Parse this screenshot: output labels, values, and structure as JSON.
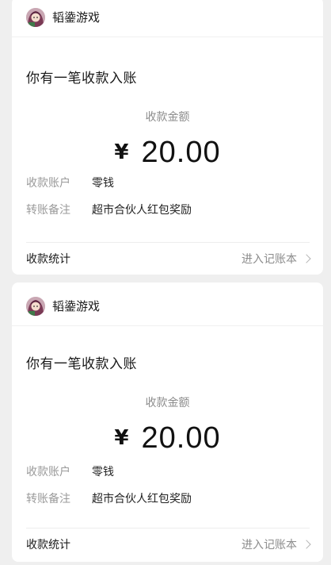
{
  "colors": {
    "background": "#efefef",
    "card": "#ffffff",
    "muted_text": "#8c8c8c",
    "primary_text": "#1a1a1a"
  },
  "cards": [
    {
      "sender": {
        "name": "韬鍌游戏",
        "avatar_icon": "anime-avatar-icon"
      },
      "title": "你有一笔收款入账",
      "amount_label": "收款金额",
      "currency_symbol": "¥",
      "amount": "20.00",
      "details": [
        {
          "key": "收款账户",
          "value": "零钱"
        },
        {
          "key": "转账备注",
          "value": "超市合伙人红包奖励"
        }
      ],
      "footer": {
        "label": "收款统计",
        "link": "进入记账本",
        "link_icon": "chevron-right-icon"
      }
    },
    {
      "sender": {
        "name": "韬鍌游戏",
        "avatar_icon": "anime-avatar-icon"
      },
      "title": "你有一笔收款入账",
      "amount_label": "收款金额",
      "currency_symbol": "¥",
      "amount": "20.00",
      "details": [
        {
          "key": "收款账户",
          "value": "零钱"
        },
        {
          "key": "转账备注",
          "value": "超市合伙人红包奖励"
        }
      ],
      "footer": {
        "label": "收款统计",
        "link": "进入记账本",
        "link_icon": "chevron-right-icon"
      }
    }
  ]
}
